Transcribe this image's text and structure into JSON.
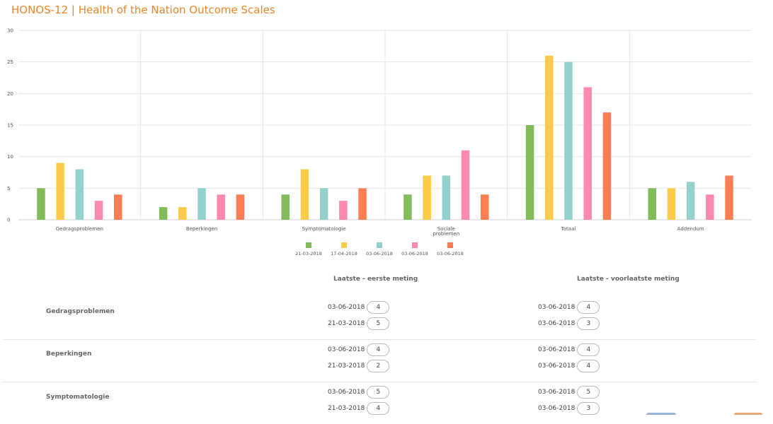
{
  "page": {
    "title": "HONOS-12 | Health of the Nation Outcome Scales"
  },
  "chart_data": {
    "type": "bar",
    "categories": [
      "Gedragsproblemen",
      "Beperkingen",
      "Symptomatologie",
      "Sociale problemen",
      "Totaal",
      "Addendum"
    ],
    "category_lines": [
      [
        "Gedragsproblemen"
      ],
      [
        "Beperkingen"
      ],
      [
        "Symptomatologie"
      ],
      [
        "Sociale",
        "problemen"
      ],
      [
        "Totaal"
      ],
      [
        "Addendum"
      ]
    ],
    "series": [
      {
        "name": "21-03-2018",
        "color": "#82bb5a",
        "values": [
          5,
          2,
          4,
          4,
          15,
          5
        ]
      },
      {
        "name": "17-04-2018",
        "color": "#fccb4a",
        "values": [
          9,
          2,
          8,
          7,
          26,
          5
        ]
      },
      {
        "name": "03-06-2018",
        "color": "#94d1cc",
        "values": [
          8,
          5,
          5,
          7,
          25,
          6
        ]
      },
      {
        "name": "03-06-2018",
        "color": "#fd88b2",
        "values": [
          3,
          4,
          3,
          11,
          21,
          4
        ]
      },
      {
        "name": "03-06-2018",
        "color": "#fd7e54",
        "values": [
          4,
          4,
          5,
          4,
          17,
          7
        ]
      }
    ],
    "yticks": [
      0,
      5,
      10,
      15,
      20,
      25,
      30
    ],
    "ylim": [
      0,
      30
    ],
    "grid": true,
    "legend": "bottom-center"
  },
  "comparison": {
    "col1_title": "Laatste - eerste meting",
    "col2_title": "Laatste - voorlaatste meting",
    "rows": [
      {
        "label": "Gedragsproblemen",
        "col1": [
          {
            "date": "03-06-2018",
            "value": "4"
          },
          {
            "date": "21-03-2018",
            "value": "5"
          }
        ],
        "col2": [
          {
            "date": "03-06-2018",
            "value": "4"
          },
          {
            "date": "03-06-2018",
            "value": "3"
          }
        ]
      },
      {
        "label": "Beperkingen",
        "col1": [
          {
            "date": "03-06-2018",
            "value": "4"
          },
          {
            "date": "21-03-2018",
            "value": "2"
          }
        ],
        "col2": [
          {
            "date": "03-06-2018",
            "value": "4"
          },
          {
            "date": "03-06-2018",
            "value": "4"
          }
        ]
      },
      {
        "label": "Symptomatologie",
        "col1": [
          {
            "date": "03-06-2018",
            "value": "5"
          },
          {
            "date": "21-03-2018",
            "value": "4"
          }
        ],
        "col2": [
          {
            "date": "03-06-2018",
            "value": "5"
          },
          {
            "date": "03-06-2018",
            "value": "3"
          }
        ]
      }
    ]
  }
}
